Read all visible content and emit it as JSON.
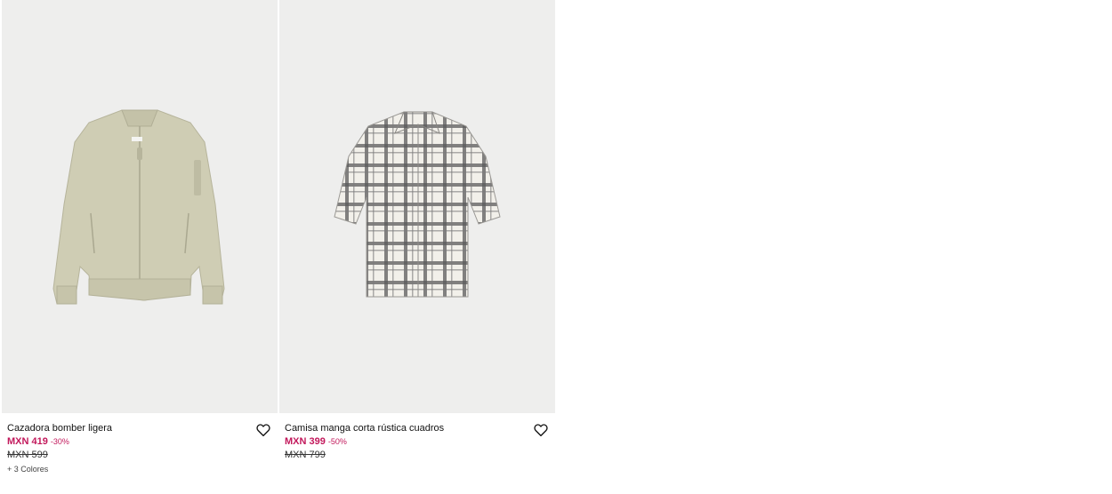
{
  "products": [
    {
      "name": "Cazadora bomber ligera",
      "price": "MXN 419",
      "discount": "-30%",
      "old_price": "MXN 599",
      "colors_label": "+ 3 Colores",
      "image_icon": "bomber-jacket-image"
    },
    {
      "name": "Camisa manga corta rústica cuadros",
      "price": "MXN 399",
      "discount": "-50%",
      "old_price": "MXN 799",
      "image_icon": "plaid-shirt-image"
    }
  ],
  "icons": {
    "favorite": "heart-outline-icon"
  },
  "colors": {
    "price_accent": "#c2185b",
    "image_background": "#eeeeed",
    "jacket": "#cfcdb4",
    "shirt_base": "#f2f0ea",
    "shirt_check": "#4a4a4a"
  }
}
